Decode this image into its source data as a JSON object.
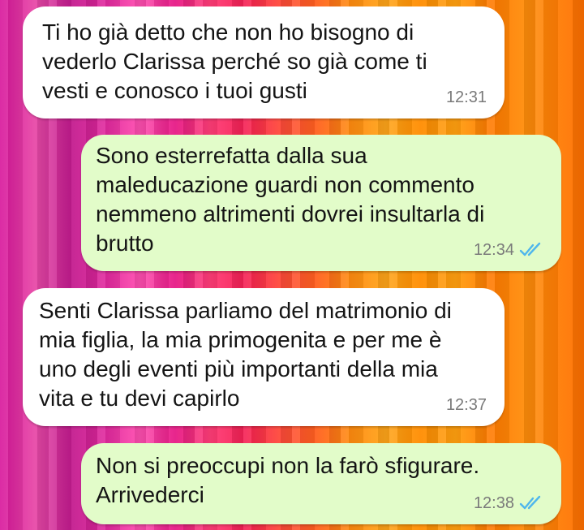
{
  "messages": [
    {
      "direction": "incoming",
      "text": "Ti ho già detto che non ho bisogno di\nvederlo Clarissa perché so già come ti\nvesti e conosco i tuoi gusti",
      "time": "12:31"
    },
    {
      "direction": "outgoing",
      "text": "Sono esterrefatta dalla sua\nmaleducazione guardi non commento\nnemmeno altrimenti dovrei insultarla di\nbrutto",
      "time": "12:34",
      "status_icon": "double-check-read-icon"
    },
    {
      "direction": "incoming",
      "text": "Senti Clarissa parliamo del matrimonio di\nmia figlia, la mia primogenita e per me è\nuno degli eventi più importanti della mia\nvita e tu devi capirlo",
      "time": "12:37"
    },
    {
      "direction": "outgoing",
      "text": "Non si preoccupi non la farò sfigurare.\nArrivederci",
      "time": "12:38",
      "status_icon": "double-check-read-icon"
    }
  ],
  "colors": {
    "incoming_bubble": "#ffffff",
    "outgoing_bubble": "#e2fcc9",
    "read_receipt": "#4fb6ec",
    "timestamp": "#7a7a7a"
  }
}
